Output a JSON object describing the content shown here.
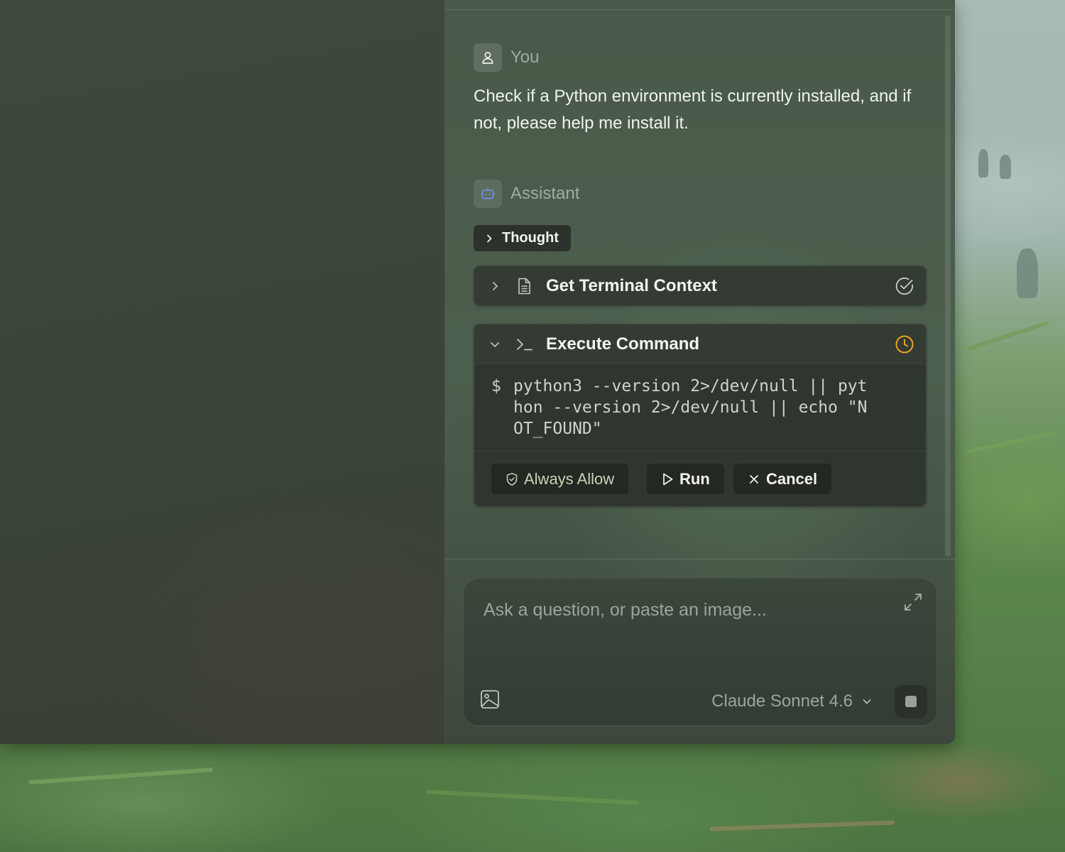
{
  "conversation": {
    "user": {
      "role_label": "You",
      "avatar_icon": "user-icon",
      "message": "Check if a Python environment is currently installed, and if not, please help me install it."
    },
    "assistant": {
      "role_label": "Assistant",
      "avatar_icon": "bot-icon",
      "thought_label": "Thought",
      "tools": [
        {
          "name": "Get Terminal Context",
          "icon": "document-icon",
          "state": "collapsed",
          "status_icon": "check-circle-icon"
        },
        {
          "name": "Execute Command",
          "icon": "terminal-icon",
          "state": "expanded",
          "status_icon": "clock-icon",
          "prompt": "$",
          "command": "python3 --version 2>/dev/null || python --version 2>/dev/null || echo \"NOT_FOUND\"",
          "actions": {
            "always_allow": "Always Allow",
            "run": "Run",
            "cancel": "Cancel"
          }
        }
      ]
    }
  },
  "composer": {
    "placeholder": "Ask a question, or paste an image...",
    "model": "Claude Sonnet 4.6"
  },
  "colors": {
    "pending_status": "#e8a22a",
    "success_status": "#c8cfc6",
    "bot_accent": "#6f8fe8"
  }
}
